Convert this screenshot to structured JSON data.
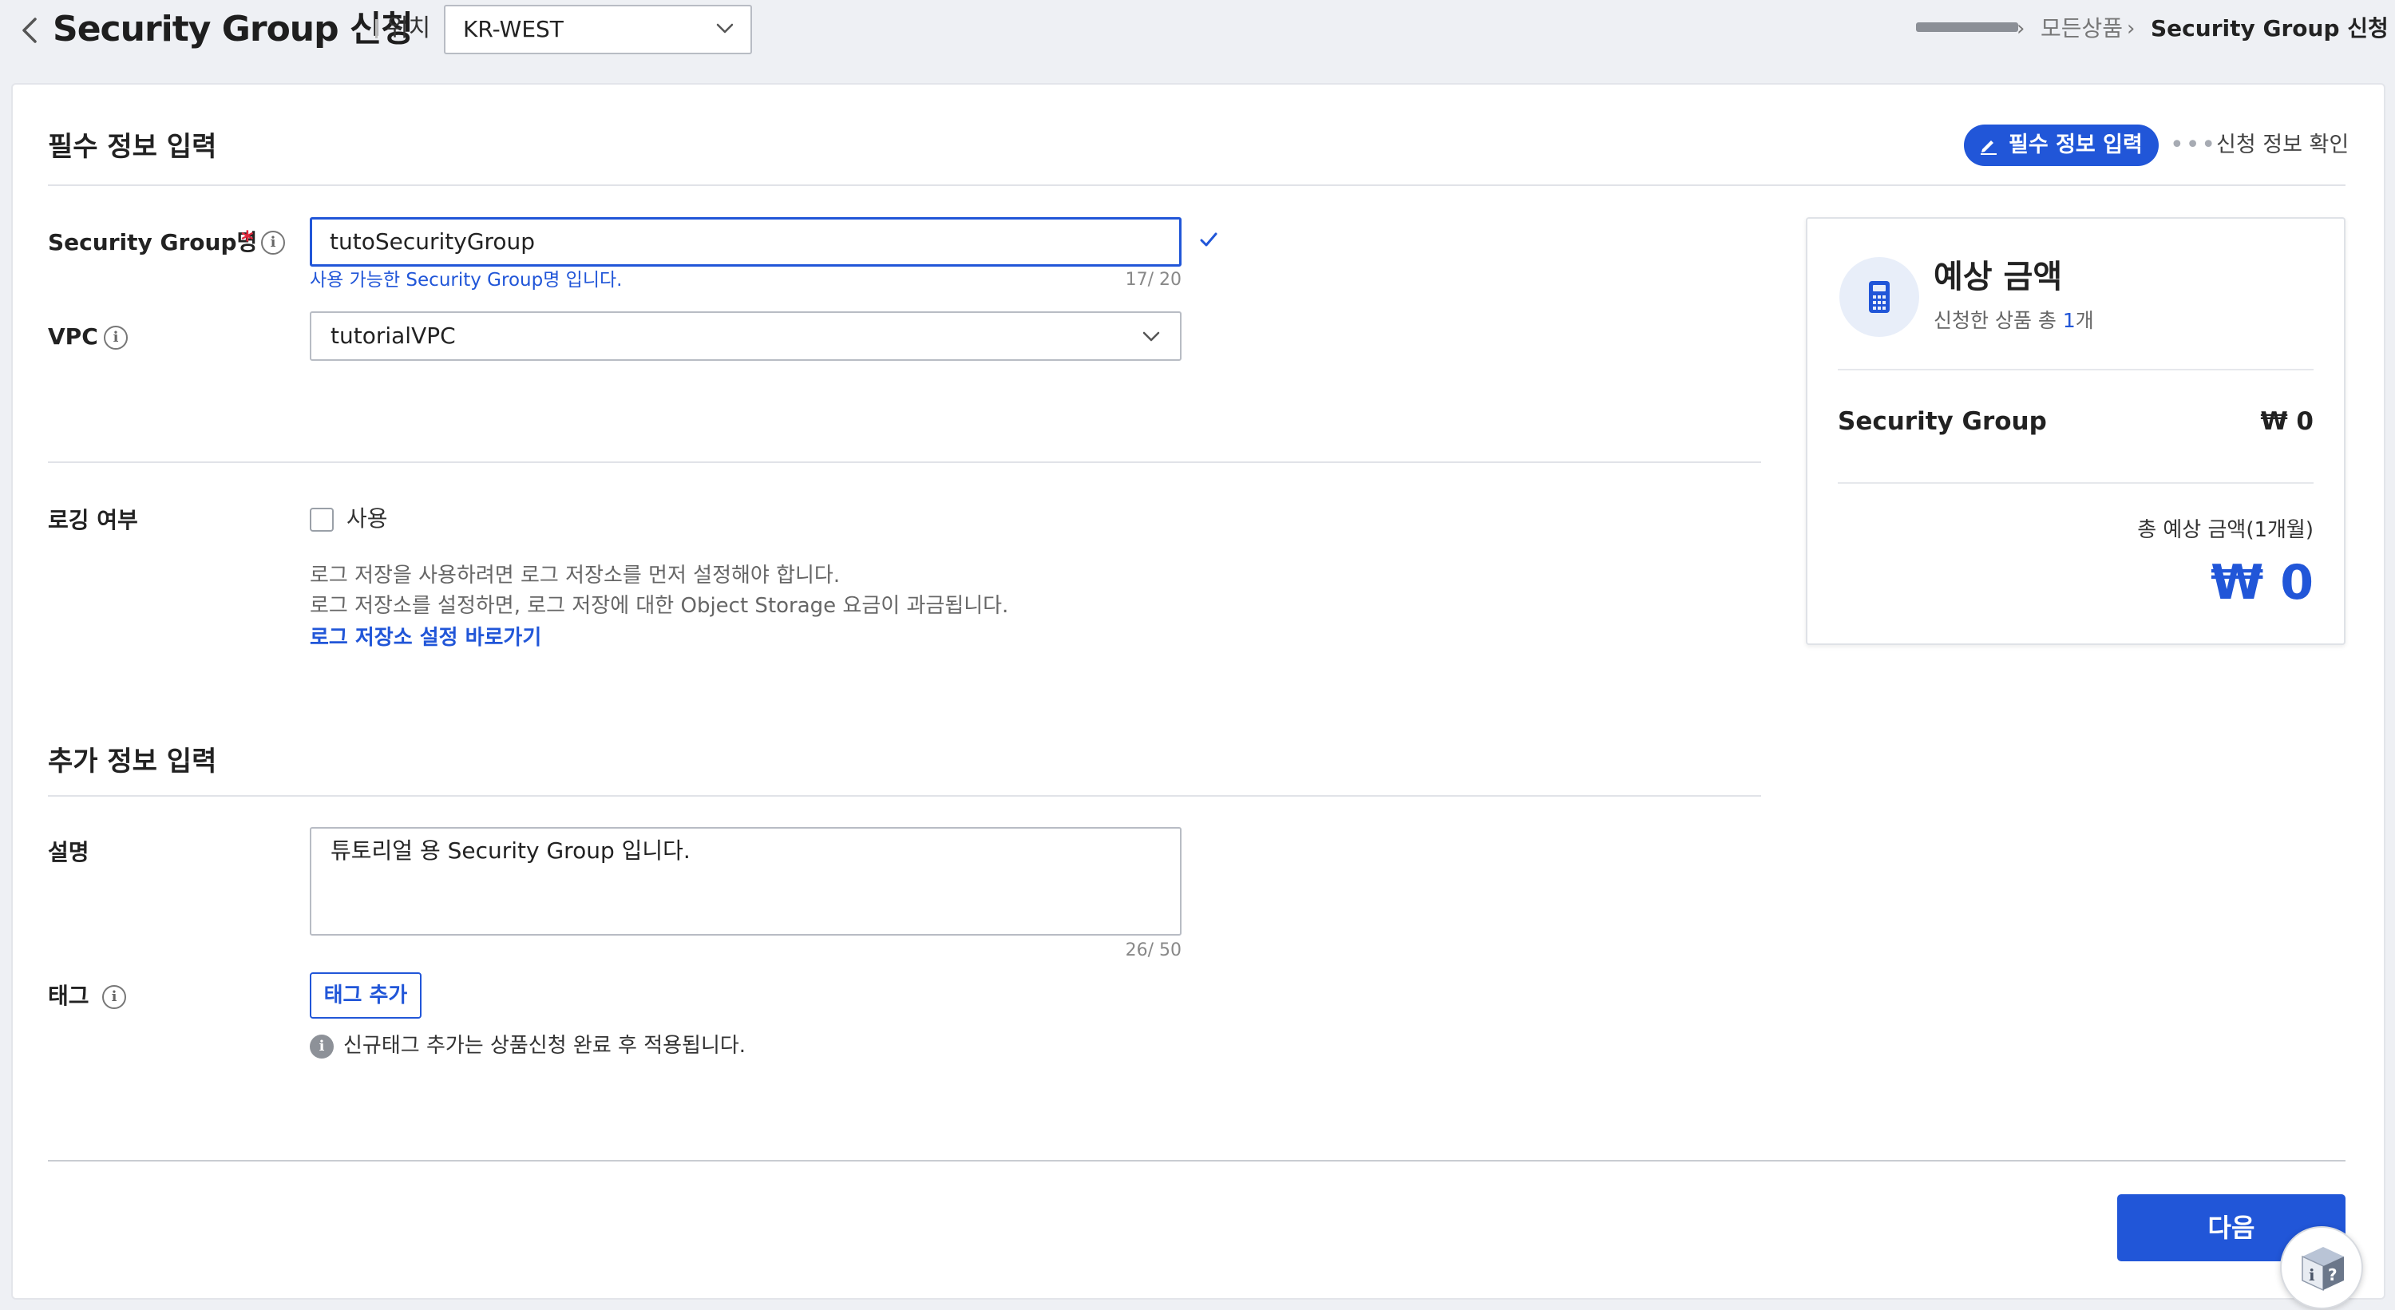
{
  "header": {
    "title": "Security Group 신청",
    "location_label": "위치",
    "region_value": "KR-WEST",
    "breadcrumb": {
      "all_products": "모든상품",
      "current": "Security Group 신청"
    }
  },
  "steps": {
    "active": "필수 정보 입력",
    "next": "신청 정보 확인"
  },
  "required_section": {
    "title": "필수 정보 입력",
    "sg_name_label": "Security Group명",
    "required_mark": "*",
    "sg_name_value": "tutoSecurityGroup",
    "sg_name_helper": "사용 가능한 Security Group명 입니다.",
    "sg_name_counter": "17/ 20",
    "vpc_label": "VPC",
    "vpc_value": "tutorialVPC",
    "logging_label": "로깅 여부",
    "logging_checkbox_label": "사용",
    "logging_checked": false,
    "logging_desc_1": "로그 저장을 사용하려면 로그 저장소를 먼저 설정해야 합니다.",
    "logging_desc_2": "로그 저장소를 설정하면, 로그 저장에 대한 Object Storage 요금이 과금됩니다.",
    "logging_link": "로그 저장소 설정 바로가기"
  },
  "additional_section": {
    "title": "추가 정보 입력",
    "desc_label": "설명",
    "desc_value": "튜토리얼 용 Security Group 입니다.",
    "desc_counter": "26/ 50",
    "tag_label": "태그",
    "tag_button": "태그 추가",
    "tag_notice": "신규태그 추가는 상품신청 완료 후 적용됩니다."
  },
  "price_panel": {
    "title": "예상 금액",
    "subtitle_prefix": "신청한 상품 총 ",
    "subtitle_count": "1",
    "subtitle_suffix": "개",
    "item_name": "Security Group",
    "item_price": "₩ 0",
    "total_label": "총 예상 금액(1개월)",
    "total_value": "₩ 0"
  },
  "footer": {
    "next_button": "다음"
  },
  "icons": {
    "back": "chevron-left-icon",
    "info": "info-icon",
    "check": "checkmark-icon",
    "calculator": "calculator-icon",
    "pencil": "pencil-icon",
    "help": "help-box-icon"
  },
  "colors": {
    "accent": "#2156d8",
    "required": "#e0263a",
    "background": "#eef0f4"
  }
}
